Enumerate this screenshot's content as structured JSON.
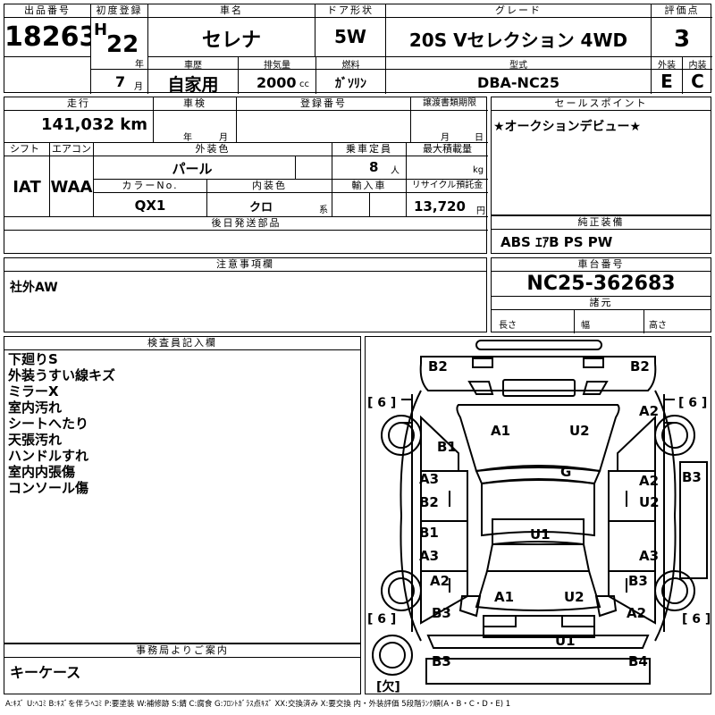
{
  "header": {
    "lot_label": "出品番号",
    "lot_no": "18263",
    "first_reg_label": "初度登録",
    "era": "H",
    "year": "22",
    "year_unit": "年",
    "month": "7",
    "month_unit": "月",
    "name_label": "車名",
    "name": "セレナ",
    "door_label": "ドア形状",
    "door": "5W",
    "grade_label": "グレード",
    "grade": "20S Vセレクション 4WD",
    "score_label": "評価点",
    "score": "3",
    "history_label": "車歴",
    "history": "自家用",
    "displacement_label": "排気量",
    "displacement": "2000",
    "displacement_unit": "cc",
    "fuel_label": "燃料",
    "fuel": "ｶﾞｿﾘﾝ",
    "model_label": "型式",
    "model": "DBA-NC25",
    "exterior_label": "外装",
    "exterior": "E",
    "interior_label": "内装",
    "interior": "C"
  },
  "row2": {
    "mileage_label": "走行",
    "mileage": "141,032 km",
    "inspection_label": "車検",
    "inspection_year_unit": "年",
    "inspection_month_unit": "月",
    "regno_label": "登録番号",
    "transfer_label": "譲渡書類期限",
    "transfer_month_unit": "月",
    "transfer_day_unit": "日",
    "shift_label": "シフト",
    "shift": "IAT",
    "ac_label": "エアコン",
    "ac": "WAA",
    "color_label": "外装色",
    "color": "パール",
    "capacity_label": "乗車定員",
    "capacity": "8",
    "capacity_unit": "人",
    "load_label": "最大積載量",
    "load_unit": "kg",
    "color_no_label": "カラーNo.",
    "color_no": "QX1",
    "interior_color_label": "内装色",
    "interior_color": "クロ",
    "interior_color_unit": "系",
    "import_label": "輸入車",
    "recycle_label": "リサイクル預託金",
    "recycle": "13,720",
    "recycle_unit": "円",
    "later_parts_label": "後日発送部品"
  },
  "sales_point": {
    "label": "セールスポイント",
    "text": "★オークションデビュー★"
  },
  "equipment": {
    "label": "純正装備",
    "text": "ABS ｴｱB PS PW"
  },
  "caution": {
    "label": "注意事項欄",
    "text": "社外AW"
  },
  "chassis": {
    "label": "車台番号",
    "number": "NC25-362683",
    "specs_label": "諸元",
    "length_label": "長さ",
    "width_label": "幅",
    "height_label": "高さ"
  },
  "inspector": {
    "label": "検査員記入欄",
    "lines": [
      "下廻りS",
      "外装うすい線キズ",
      "ミラーX",
      "室内汚れ",
      "シートへたり",
      "天張汚れ",
      "ハンドルすれ",
      "室内内張傷",
      "コンソール傷"
    ]
  },
  "office": {
    "label": "事務局よりご案内",
    "text": "キーケース"
  },
  "diagram": {
    "marks": [
      "B2",
      "B2",
      "A2",
      "B1",
      "A1",
      "U2",
      "G",
      "B3",
      "A3",
      "A2",
      "B2",
      "U2",
      "U1",
      "B1",
      "A3",
      "A3",
      "A2",
      "B3",
      "A1",
      "U2",
      "B3",
      "A2",
      "U1",
      "B3",
      "B4"
    ],
    "tire_marks": [
      "[ 6 ]",
      "[ 6 ]",
      "[ 6 ]",
      "[ 6 ]"
    ],
    "spare_mark": "[欠]"
  },
  "legend": "A:ｷｽﾞ U:ﾍｺﾐ B:ｷｽﾞを伴うﾍｺﾐ P:要塗装 W:補修跡 S:錆 C:腐食 G:ﾌﾛﾝﾄｶﾞﾗｽ点ｷｽﾞ XX:交換済み X:要交換 内・外装評価 5段階ﾗﾝｸ順(A・B・C・D・E) 1"
}
